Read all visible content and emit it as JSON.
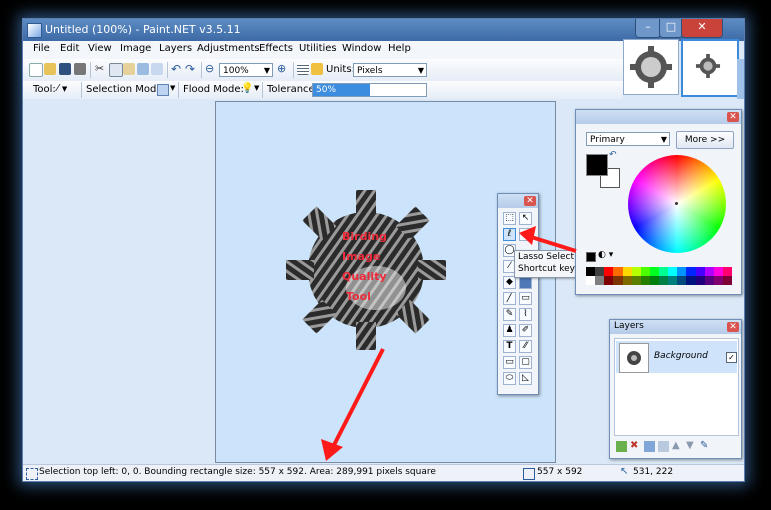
{
  "window": {
    "title": "Untitled (100%) - Paint.NET v3.5.11",
    "controls": [
      "–",
      "□",
      "✕"
    ]
  },
  "menu": [
    "File",
    "Edit",
    "View",
    "Image",
    "Layers",
    "Adjustments",
    "Effects",
    "Utilities",
    "Window",
    "Help"
  ],
  "toolbar": {
    "zoom_value": "100%",
    "units_label": "Units:",
    "units_value": "Pixels"
  },
  "tool_options": {
    "tool_label": "Tool:",
    "selection_mode_label": "Selection Mode:",
    "flood_mode_label": "Flood Mode:",
    "tolerance_label": "Tolerance:",
    "tolerance_value": "50%",
    "tolerance_fraction": 0.5
  },
  "canvas_text": [
    "Birding",
    "Image",
    "Quality",
    "Tool"
  ],
  "tools_window": {
    "tooltip_title": "Lasso Select",
    "tooltip_shortcut": "Shortcut key: S"
  },
  "colors_window": {
    "primary_select": "Primary",
    "more_button": "More >>",
    "palette": [
      "#000000",
      "#404040",
      "#ff0000",
      "#ff6a00",
      "#ffd800",
      "#b6ff00",
      "#4cff00",
      "#00ff21",
      "#00ff90",
      "#00ffff",
      "#0094ff",
      "#0026ff",
      "#4800ff",
      "#b200ff",
      "#ff00dc",
      "#ff006e",
      "#ffffff",
      "#808080",
      "#7f0000",
      "#7f3300",
      "#7f6a00",
      "#5b7f00",
      "#267f00",
      "#007f0e",
      "#007f46",
      "#007f7f",
      "#004a7f",
      "#00137f",
      "#21007f",
      "#57007f",
      "#7f006e",
      "#7f0037"
    ]
  },
  "layers_window": {
    "title": "Layers",
    "layer_name": "Background"
  },
  "status": {
    "selection_info": "Selection top left: 0, 0. Bounding rectangle size: 557 x 592. Area: 289,991 pixels square",
    "image_size": "557 x 592",
    "cursor_pos": "531, 222"
  },
  "colors": {
    "accent": "#3d6aa5",
    "arrow": "#ff1a1a"
  }
}
